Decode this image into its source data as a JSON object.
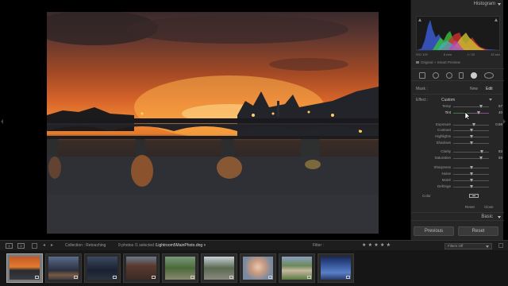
{
  "histogram": {
    "title": "Histogram",
    "info": [
      "ISO 100",
      "8 mm",
      "f / 20",
      "15 sec"
    ],
    "preview_label": "Original + Smart Preview"
  },
  "mask": {
    "label": "Mask :",
    "new_label": "New",
    "edit_label": "Edit"
  },
  "effect": {
    "label": "Effect :",
    "value": "Custom"
  },
  "sliders": [
    {
      "label": "Temp",
      "value": "67",
      "position": 0.78
    },
    {
      "label": "Tint",
      "value": "40",
      "position": 0.72
    },
    {
      "label": "Exposure",
      "value": "0.68",
      "position": 0.58
    },
    {
      "label": "Contrast",
      "value": "",
      "position": 0.5
    },
    {
      "label": "Highlights",
      "value": "",
      "position": 0.5
    },
    {
      "label": "Shadows",
      "value": "",
      "position": 0.5
    },
    {
      "label": "Clarity",
      "value": "83",
      "position": 0.8
    },
    {
      "label": "Saturation",
      "value": "59",
      "position": 0.78
    },
    {
      "label": "Sharpness",
      "value": "",
      "position": 0.5
    },
    {
      "label": "Noise",
      "value": "",
      "position": 0.5
    },
    {
      "label": "Moiré",
      "value": "",
      "position": 0.5
    },
    {
      "label": "Defringe",
      "value": "",
      "position": 0.5
    }
  ],
  "color_label": "Color",
  "reset_label": "Reset",
  "close_label": "Close",
  "basic_label": "Basic",
  "buttons": {
    "previous": "Previous",
    "reset": "Reset"
  },
  "toolbar": {
    "view1": "1",
    "view2": "2",
    "collection": "Collection : Retouching",
    "count_prefix": "9 photos /1 selected /",
    "filename": "Lightroom5MainPhoto.dng",
    "filter_label": "Filter :",
    "stars": "★ ★ ★ ★ ★",
    "filter_value": "Filters Off"
  },
  "colors": {
    "panel_bg": "#262626",
    "filmstrip_bg": "#161616",
    "selected_thumb": "#7a7a7a"
  }
}
